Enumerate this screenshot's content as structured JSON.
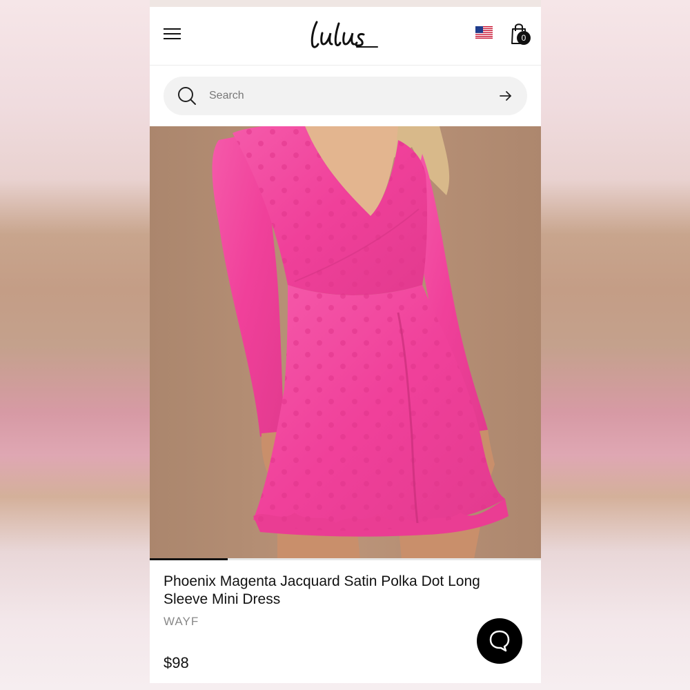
{
  "header": {
    "logo_text": "Lulus",
    "menu_icon": "hamburger-menu-icon",
    "flag_icon": "us-flag-icon",
    "bag_icon": "shopping-bag-icon",
    "bag_count": "0"
  },
  "search": {
    "placeholder": "Search",
    "value": "",
    "icon": "search-icon",
    "submit_icon": "arrow-right-icon"
  },
  "product": {
    "image_alt": "Phoenix Magenta Jacquard Satin Polka Dot Long Sleeve Mini Dress",
    "title": "Phoenix Magenta Jacquard Satin Polka Dot Long Sleeve Mini Dress",
    "brand": "WAYF",
    "price": "$98",
    "gallery_progress": 0.2
  },
  "chat": {
    "icon": "chat-bubble-icon"
  },
  "colors": {
    "dress": "#f0409a",
    "backdrop": "#b58e74",
    "accent": "#111111"
  }
}
